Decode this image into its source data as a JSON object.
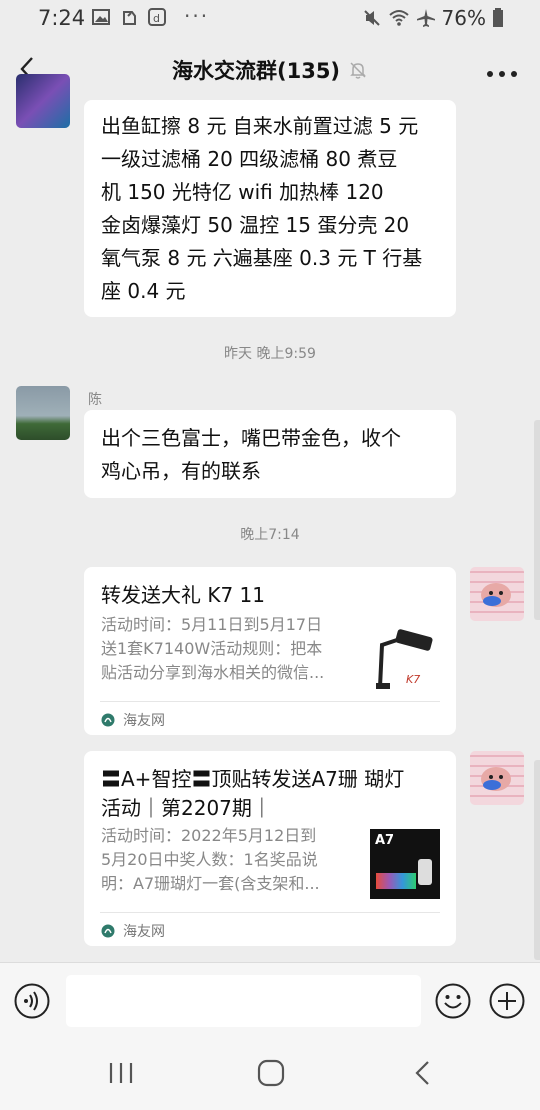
{
  "status_bar": {
    "time": "7:24",
    "dots": "···",
    "battery_text": "76%"
  },
  "header": {
    "title": "海水交流群(135)"
  },
  "messages": {
    "m1_lines": [
      "出鱼缸擦 8 元  自来水前置过滤 5 元",
      "一级过滤桶 20  四级滤桶 80   煮豆",
      "机 150    光特亿 wifi 加热棒 120",
      "金卤爆藻灯 50  温控 15  蛋分壳 20",
      "氧气泵 8 元 六遍基座 0.3 元    T 行基",
      "座 0.4 元"
    ],
    "ts1": "昨天 晚上9:59",
    "sender2": "陈",
    "m2_lines": [
      "出个三色富士，嘴巴带金色，收个",
      "鸡心吊，有的联系"
    ],
    "ts2": "晚上7:14",
    "card1": {
      "title": "转发送大礼 K7 11",
      "desc_lines": [
        "活动时间：5月11日到5月17日",
        "送1套K7140W活动规则：把本",
        "贴活动分享到海水相关的微信..."
      ],
      "source": "海友网",
      "thumb_text": "K7"
    },
    "card2": {
      "title_lines": [
        "〓A+智控〓顶贴转发送A7珊 瑚灯",
        "活动｜第2207期｜"
      ],
      "desc_lines": [
        "活动时间：2022年5月12日到",
        "5月20日中奖人数：1名奖品说",
        "明：A7珊瑚灯一套(含支架和..."
      ],
      "source": "海友网",
      "thumb_text": "A7"
    }
  },
  "colors": {
    "background": "#ededed",
    "bubble": "#ffffff",
    "muted_text": "#888888",
    "source_icon": "#2f7a6b"
  },
  "icons": {
    "back": "chevron-left-icon",
    "mute": "bell-off-icon",
    "more": "more-dots-icon",
    "voice": "voice-icon",
    "emoji": "emoji-icon",
    "add": "plus-circle-icon"
  }
}
